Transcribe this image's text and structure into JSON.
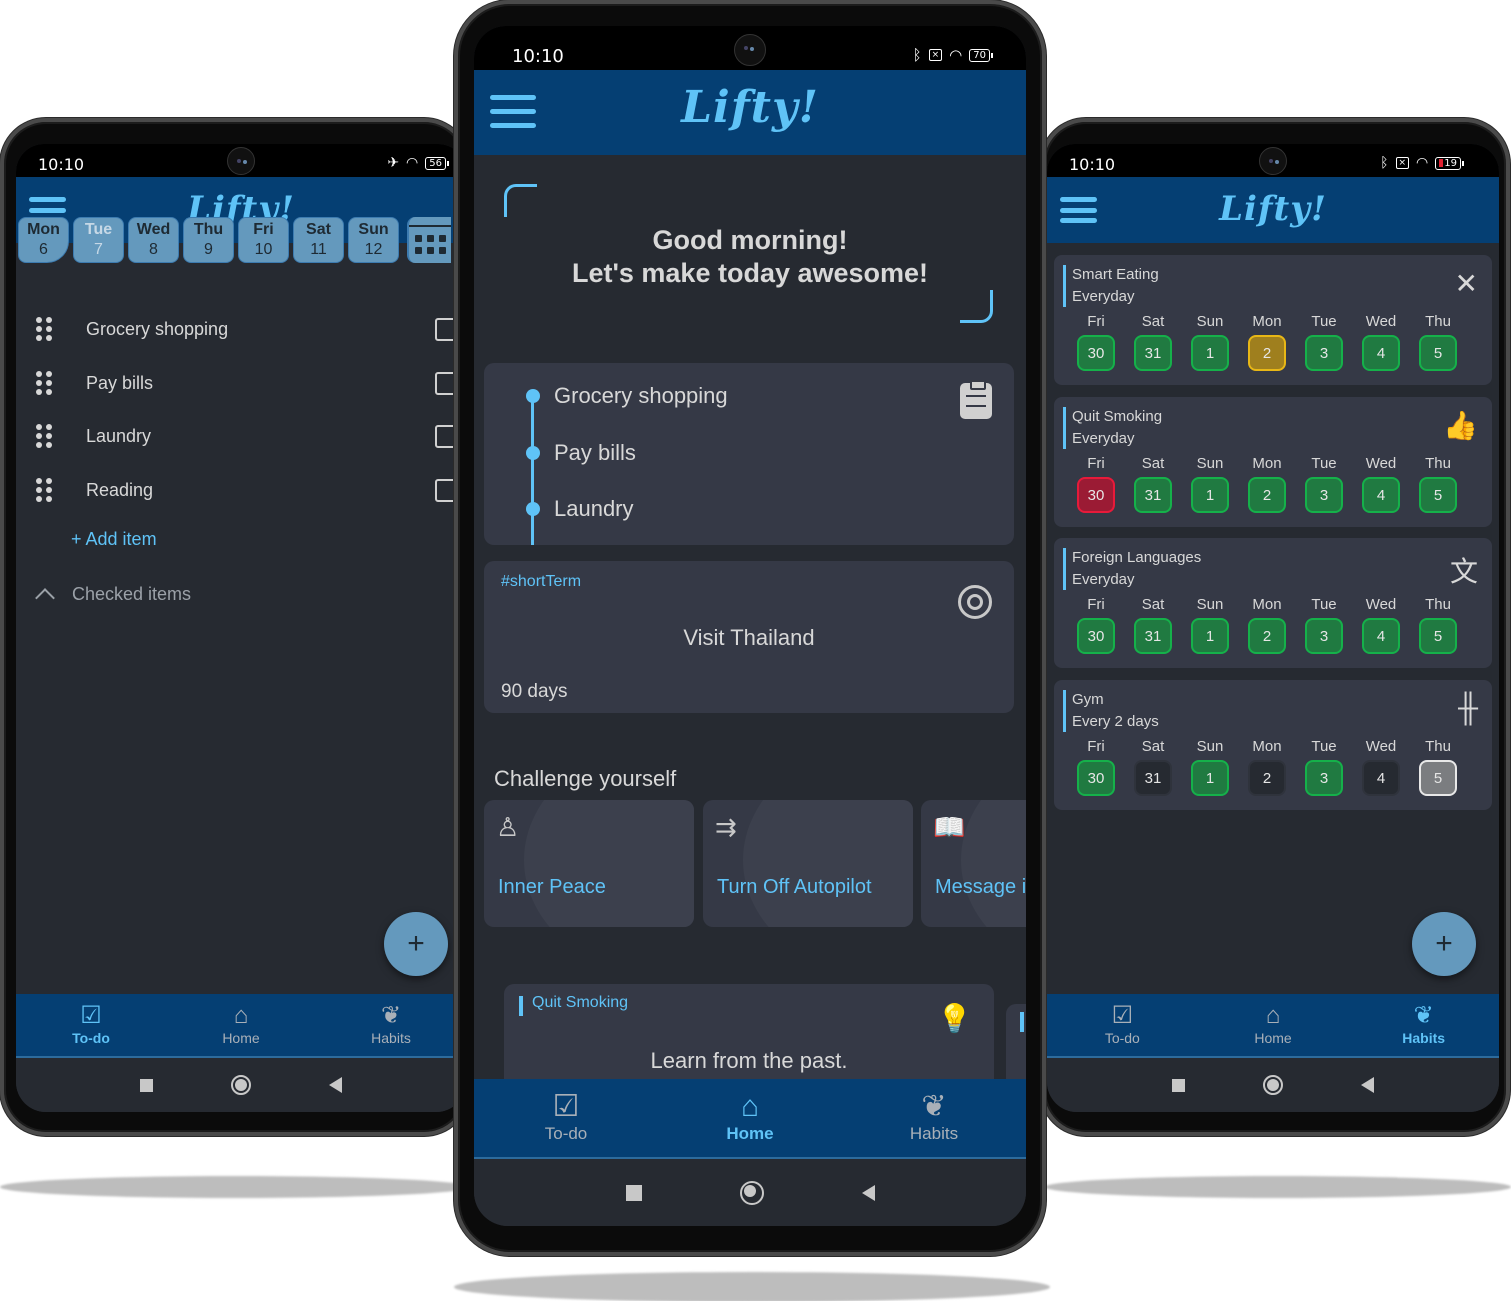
{
  "app": {
    "logo": "Lifty!",
    "accent_color": "#5fc3f7",
    "appbar_color": "#053f73",
    "background_color": "#262a31",
    "card_color": "#353946"
  },
  "nav": {
    "todo": "To-do",
    "home": "Home",
    "habits": "Habits"
  },
  "phones": {
    "left": {
      "status": {
        "time": "10:10",
        "battery": "56",
        "icons": [
          "airplane-icon",
          "wifi-icon",
          "battery-icon"
        ]
      },
      "active_tab": "To-do",
      "days": [
        {
          "name": "Mon",
          "date": "6",
          "selected": true
        },
        {
          "name": "Tue",
          "date": "7",
          "dimmed": true
        },
        {
          "name": "Wed",
          "date": "8"
        },
        {
          "name": "Thu",
          "date": "9"
        },
        {
          "name": "Fri",
          "date": "10"
        },
        {
          "name": "Sat",
          "date": "11"
        },
        {
          "name": "Sun",
          "date": "12"
        }
      ],
      "todos": [
        {
          "text": "Grocery shopping",
          "checked": false
        },
        {
          "text": "Pay bills",
          "checked": false
        },
        {
          "text": "Laundry",
          "checked": false
        },
        {
          "text": "Reading",
          "checked": false
        }
      ],
      "add_item": "Add item",
      "checked_items": "Checked items",
      "fab": "+"
    },
    "center": {
      "status": {
        "time": "10:10",
        "battery": "70",
        "icons": [
          "bluetooth-icon",
          "no-sim-icon",
          "wifi-icon",
          "battery-icon"
        ]
      },
      "active_tab": "Home",
      "greeting_line1": "Good morning!",
      "greeting_line2": "Let's make today awesome!",
      "todo_preview": [
        "Grocery shopping",
        "Pay bills",
        "Laundry"
      ],
      "goal": {
        "tag": "#shortTerm",
        "title": "Visit Thailand",
        "days": "90 days"
      },
      "challenge_title": "Challenge yourself",
      "challenges": [
        {
          "label": "Inner Peace",
          "icon": "meditation-icon"
        },
        {
          "label": "Turn Off Autopilot",
          "icon": "direction-arrows-icon"
        },
        {
          "label": "Message i",
          "icon": "open-book-pen-icon"
        }
      ],
      "quote": {
        "tag": "Quit Smoking",
        "text": "Learn from the past."
      }
    },
    "right": {
      "status": {
        "time": "10:10",
        "battery": "19",
        "icons": [
          "bluetooth-icon",
          "no-sim-icon",
          "wifi-icon",
          "battery-low-icon"
        ]
      },
      "active_tab": "Habits",
      "habits": [
        {
          "name": "Smart Eating",
          "frequency": "Everyday",
          "icon": "fork-knife-icon",
          "glyph": "✕",
          "days": [
            {
              "d": "Fri",
              "n": "30",
              "s": "done"
            },
            {
              "d": "Sat",
              "n": "31",
              "s": "done"
            },
            {
              "d": "Sun",
              "n": "1",
              "s": "done"
            },
            {
              "d": "Mon",
              "n": "2",
              "s": "partial"
            },
            {
              "d": "Tue",
              "n": "3",
              "s": "done"
            },
            {
              "d": "Wed",
              "n": "4",
              "s": "done"
            },
            {
              "d": "Thu",
              "n": "5",
              "s": "done"
            }
          ]
        },
        {
          "name": "Quit Smoking",
          "frequency": "Everyday",
          "icon": "thumbs-up-cigarettes-icon",
          "glyph": "👍",
          "days": [
            {
              "d": "Fri",
              "n": "30",
              "s": "missed"
            },
            {
              "d": "Sat",
              "n": "31",
              "s": "done"
            },
            {
              "d": "Sun",
              "n": "1",
              "s": "done"
            },
            {
              "d": "Mon",
              "n": "2",
              "s": "done"
            },
            {
              "d": "Tue",
              "n": "3",
              "s": "done"
            },
            {
              "d": "Wed",
              "n": "4",
              "s": "done"
            },
            {
              "d": "Thu",
              "n": "5",
              "s": "done"
            }
          ]
        },
        {
          "name": "Foreign Languages",
          "frequency": "Everyday",
          "icon": "translate-icon",
          "glyph": "文",
          "days": [
            {
              "d": "Fri",
              "n": "30",
              "s": "done"
            },
            {
              "d": "Sat",
              "n": "31",
              "s": "done"
            },
            {
              "d": "Sun",
              "n": "1",
              "s": "done"
            },
            {
              "d": "Mon",
              "n": "2",
              "s": "done"
            },
            {
              "d": "Tue",
              "n": "3",
              "s": "done"
            },
            {
              "d": "Wed",
              "n": "4",
              "s": "done"
            },
            {
              "d": "Thu",
              "n": "5",
              "s": "done"
            }
          ]
        },
        {
          "name": "Gym",
          "frequency": "Every 2 days",
          "icon": "dumbbell-icon",
          "glyph": "╫",
          "days": [
            {
              "d": "Fri",
              "n": "30",
              "s": "done"
            },
            {
              "d": "Sat",
              "n": "31",
              "s": "off"
            },
            {
              "d": "Sun",
              "n": "1",
              "s": "done"
            },
            {
              "d": "Mon",
              "n": "2",
              "s": "off"
            },
            {
              "d": "Tue",
              "n": "3",
              "s": "done"
            },
            {
              "d": "Wed",
              "n": "4",
              "s": "off"
            },
            {
              "d": "Thu",
              "n": "5",
              "s": "today"
            }
          ]
        }
      ],
      "fab": "+"
    }
  }
}
